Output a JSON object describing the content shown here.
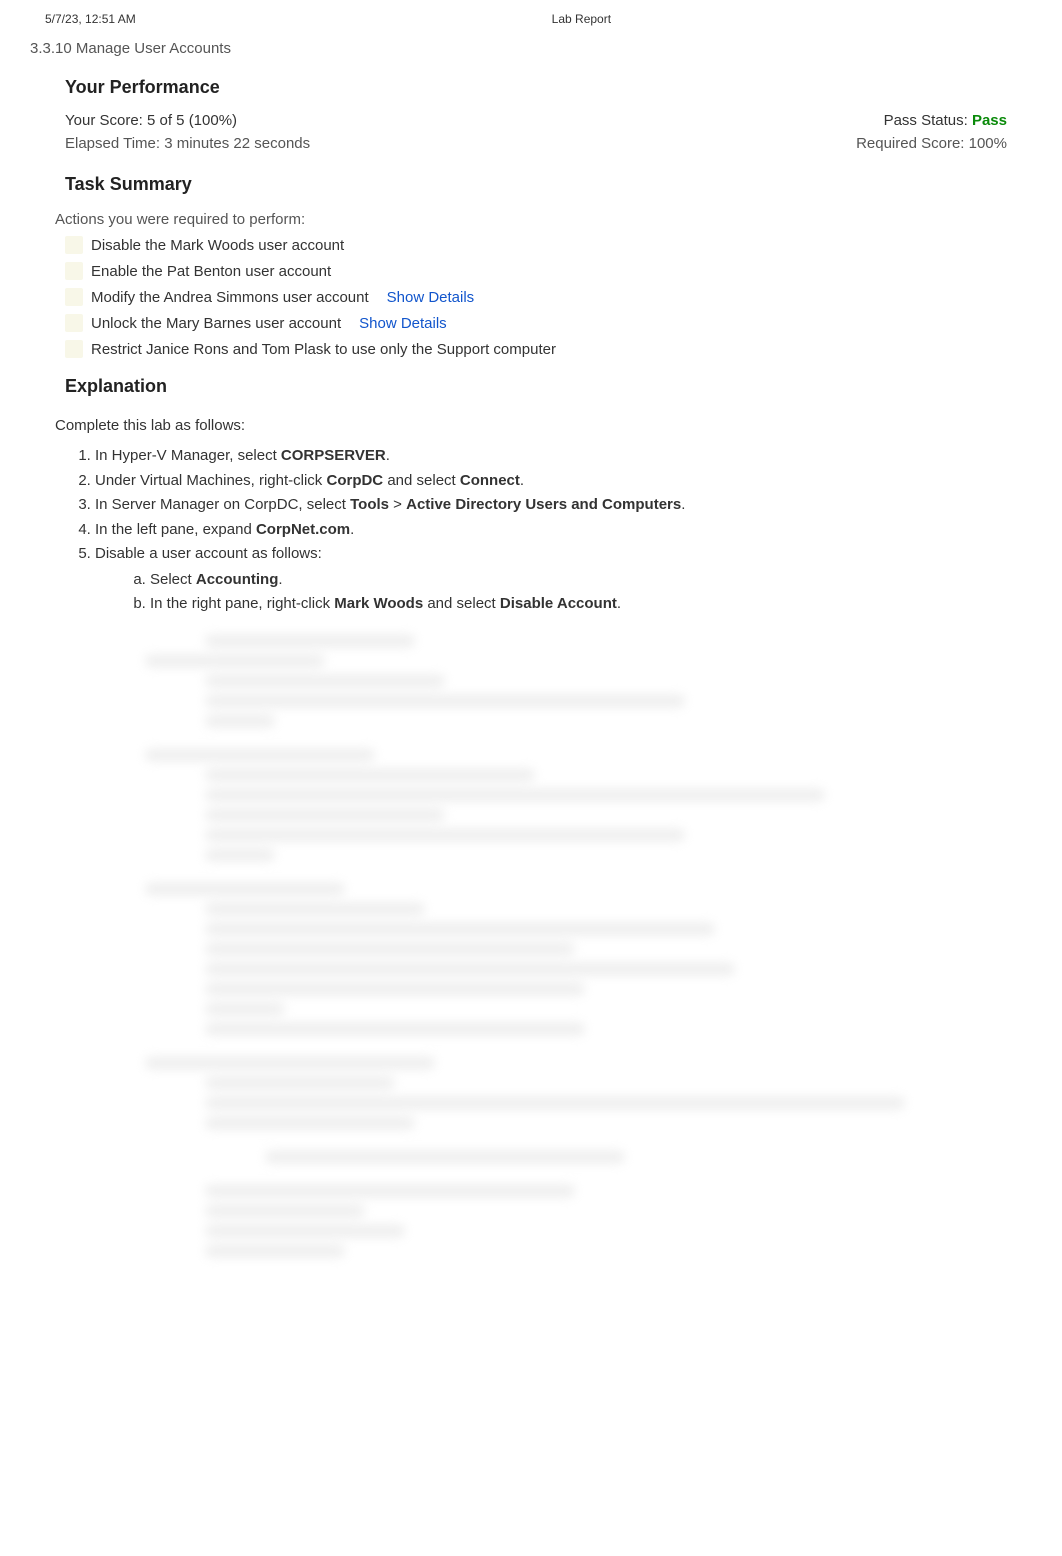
{
  "header": {
    "timestamp": "5/7/23, 12:51 AM",
    "title": "Lab Report"
  },
  "breadcrumb": "3.3.10 Manage User Accounts",
  "performance": {
    "heading": "Your Performance",
    "score_text": "Your Score: 5 of 5 (100%)",
    "pass_label": "Pass Status: ",
    "pass_value": "Pass",
    "elapsed": "Elapsed Time: 3 minutes 22 seconds",
    "required": "Required Score: 100%"
  },
  "task_summary": {
    "heading": "Task Summary",
    "intro": "Actions you were required to perform:",
    "tasks": [
      {
        "text": "Disable the Mark Woods user account",
        "details": false
      },
      {
        "text": "Enable the Pat Benton user account",
        "details": false
      },
      {
        "text": "Modify the Andrea Simmons user account",
        "details": true
      },
      {
        "text": "Unlock the Mary Barnes user account",
        "details": true
      },
      {
        "text": "Restrict Janice Rons and Tom Plask to use only the Support computer",
        "details": false
      }
    ],
    "show_details_label": "Show Details"
  },
  "explanation": {
    "heading": "Explanation",
    "intro": "Complete this lab as follows:",
    "steps": {
      "s1_pre": "In Hyper-V Manager, select ",
      "s1_b1": "CORPSERVER",
      "s1_post": ".",
      "s2_pre": "Under Virtual Machines, right-click ",
      "s2_b1": "CorpDC",
      "s2_mid": " and select ",
      "s2_b2": "Connect",
      "s2_post": ".",
      "s3_pre": "In Server Manager on CorpDC, select ",
      "s3_b1": "Tools",
      "s3_mid": " > ",
      "s3_b2": "Active Directory Users and Computers",
      "s3_post": ".",
      "s4_pre": "In the left pane, expand ",
      "s4_b1": "CorpNet.com",
      "s4_post": ".",
      "s5_text": "Disable a user account as follows:",
      "s5a_pre": "Select ",
      "s5a_b1": "Accounting",
      "s5a_post": ".",
      "s5b_pre": "In the right pane, right-click ",
      "s5b_b1": "Mark Woods",
      "s5b_mid": " and select ",
      "s5b_b2": "Disable Account",
      "s5b_post": "."
    }
  }
}
